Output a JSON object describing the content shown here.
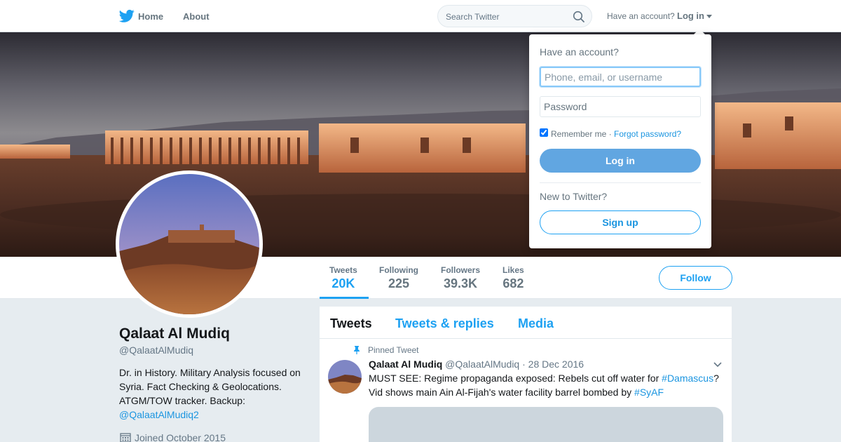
{
  "colors": {
    "brand": "#1da1f2",
    "link": "#1b95e0",
    "muted": "#657786",
    "login_button": "#61a6e1",
    "page_bg": "#e6ecf0"
  },
  "nav": {
    "logo_icon": "twitter-bird-icon",
    "home_label": "Home",
    "about_label": "About",
    "search_placeholder": "Search Twitter",
    "search_icon": "search-icon",
    "have_account": "Have an account?",
    "login_label": "Log in"
  },
  "login_dropdown": {
    "title": "Have an account?",
    "username_placeholder": "Phone, email, or username",
    "password_placeholder": "Password",
    "remember_label": "Remember me ·",
    "remember_checked": true,
    "forgot_label": "Forgot password?",
    "login_button": "Log in",
    "new_label": "New to Twitter?",
    "signup_button": "Sign up"
  },
  "profile": {
    "name": "Qalaat Al Mudiq",
    "handle": "@QalaatAlMudiq",
    "bio": "Dr. in History. Military Analysis focused on Syria. Fact Checking & Geolocations. ATGM/TOW tracker. Backup:",
    "bio_mention": "@QalaatAlMudiq2",
    "joined": "Joined October 2015",
    "calendar_icon": "calendar-icon"
  },
  "stats": [
    {
      "label": "Tweets",
      "value": "20K",
      "active": true
    },
    {
      "label": "Following",
      "value": "225"
    },
    {
      "label": "Followers",
      "value": "39.3K"
    },
    {
      "label": "Likes",
      "value": "682"
    }
  ],
  "follow_button": "Follow",
  "timeline": {
    "tabs": [
      "Tweets",
      "Tweets & replies",
      "Media"
    ],
    "active_tab": "Tweets",
    "pinned_label": "Pinned Tweet",
    "pin_icon": "pin-icon",
    "tweet": {
      "name": "Qalaat Al Mudiq",
      "handle": "@QalaatAlMudiq",
      "separator": "·",
      "date": "28 Dec 2016",
      "text_1": "MUST SEE: Regime propaganda exposed: Rebels cut off water for",
      "hashtag_1": "#Damascus",
      "text_2": "? Vid shows main Ain Al-Fijah's water facility barrel bombed by",
      "hashtag_2": "#SyAF",
      "menu_icon": "chevron-down-icon"
    }
  }
}
